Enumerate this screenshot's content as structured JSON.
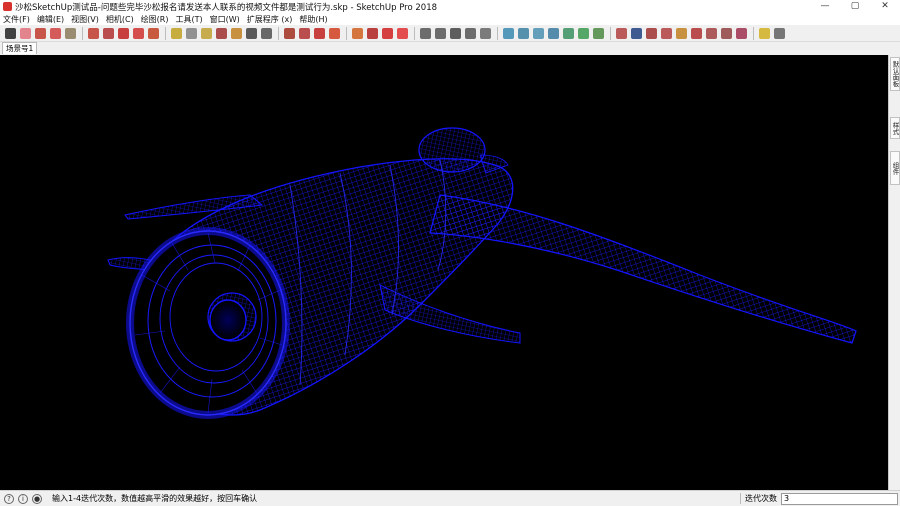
{
  "window": {
    "title": "沙松SketchUp测试品-问题些完毕沙松报名请发送本人联系的视频文件都是测试行为.skp - SketchUp Pro 2018",
    "minimize": "—",
    "maximize": "▢",
    "close": "✕"
  },
  "menu": [
    "文件(F)",
    "编辑(E)",
    "视图(V)",
    "相机(C)",
    "绘图(R)",
    "工具(T)",
    "窗口(W)",
    "扩展程序 (x)",
    "帮助(H)"
  ],
  "toolbar": {
    "icons": [
      {
        "name": "select-arrow-icon",
        "color": "#222222"
      },
      {
        "name": "eraser-icon",
        "color": "#e0707a"
      },
      {
        "name": "pencil-line-icon",
        "color": "#c0392b"
      },
      {
        "name": "arc-icon",
        "color": "#d04040"
      },
      {
        "name": "shape-icon",
        "color": "#8a7a5a"
      },
      {
        "name": "push-pull-icon",
        "color": "#c0392b"
      },
      {
        "name": "offset-icon",
        "color": "#b03030"
      },
      {
        "name": "move-icon",
        "color": "#c02020"
      },
      {
        "name": "rotate-icon",
        "color": "#d03030"
      },
      {
        "name": "scale-icon",
        "color": "#c04020"
      },
      {
        "name": "tape-measure-icon",
        "color": "#c0a020"
      },
      {
        "name": "text-label-icon",
        "color": "#808080"
      },
      {
        "name": "paint-bucket-icon",
        "color": "#c0a030"
      },
      {
        "name": "orbit-icon",
        "color": "#a03030"
      },
      {
        "name": "pan-icon",
        "color": "#c08020"
      },
      {
        "name": "zoom-icon",
        "color": "#404040"
      },
      {
        "name": "zoom-extents-icon",
        "color": "#505050"
      },
      {
        "name": "warehouse-icon",
        "color": "#a03020"
      },
      {
        "name": "extension-warehouse-icon",
        "color": "#b03030"
      },
      {
        "name": "layout-send-icon",
        "color": "#c02020"
      },
      {
        "name": "ruby-icon",
        "color": "#d04020"
      },
      {
        "name": "component-icon",
        "color": "#d06020"
      },
      {
        "name": "styles-icon",
        "color": "#b02020"
      },
      {
        "name": "folder-red-icon",
        "color": "#d02020"
      },
      {
        "name": "section-red-icon",
        "color": "#e03030"
      },
      {
        "name": "iso-view-icon",
        "color": "#555555"
      },
      {
        "name": "top-view-icon",
        "color": "#555555"
      },
      {
        "name": "front-view-icon",
        "color": "#444444"
      },
      {
        "name": "right-view-icon",
        "color": "#555555"
      },
      {
        "name": "back-view-icon",
        "color": "#666666"
      },
      {
        "name": "xray-icon",
        "color": "#3a8ab0"
      },
      {
        "name": "back-edges-icon",
        "color": "#3a80a0"
      },
      {
        "name": "wireframe-icon",
        "color": "#4a90b0"
      },
      {
        "name": "hidden-line-icon",
        "color": "#3a7aa0"
      },
      {
        "name": "shaded-icon",
        "color": "#3a9060"
      },
      {
        "name": "textured-icon",
        "color": "#3a9a50"
      },
      {
        "name": "mono-icon",
        "color": "#4a8a40"
      },
      {
        "name": "sandbox-1-icon",
        "color": "#b04040"
      },
      {
        "name": "sandbox-2-icon",
        "color": "#204080"
      },
      {
        "name": "sandbox-3-icon",
        "color": "#a03030"
      },
      {
        "name": "sandbox-4-icon",
        "color": "#b04040"
      },
      {
        "name": "sandbox-5-icon",
        "color": "#c08020"
      },
      {
        "name": "sandbox-6-icon",
        "color": "#b03030"
      },
      {
        "name": "sandbox-7-icon",
        "color": "#a04040"
      },
      {
        "name": "sandbox-8-icon",
        "color": "#904040"
      },
      {
        "name": "sandbox-9-icon",
        "color": "#a03050"
      },
      {
        "name": "plugin-yellow-icon",
        "color": "#d0b020"
      },
      {
        "name": "plugin-tool-icon",
        "color": "#606060"
      }
    ],
    "separators_after": [
      4,
      9,
      16,
      20,
      24,
      29,
      36,
      45
    ]
  },
  "scene_tab": "场景号1",
  "tray": {
    "tabs": [
      "默认面板",
      "样式",
      "组件"
    ]
  },
  "viewport": {
    "background": "#000000",
    "wire_color": "#1a1aff",
    "model": "wireframe-airplane"
  },
  "status": {
    "help_icon": "?",
    "info_icon": "i",
    "user_icon": "●",
    "message": "输入1-4迭代次数，数值越高平滑的效果越好，按回车确认",
    "vcb_label": "迭代次数",
    "vcb_value": "3"
  }
}
